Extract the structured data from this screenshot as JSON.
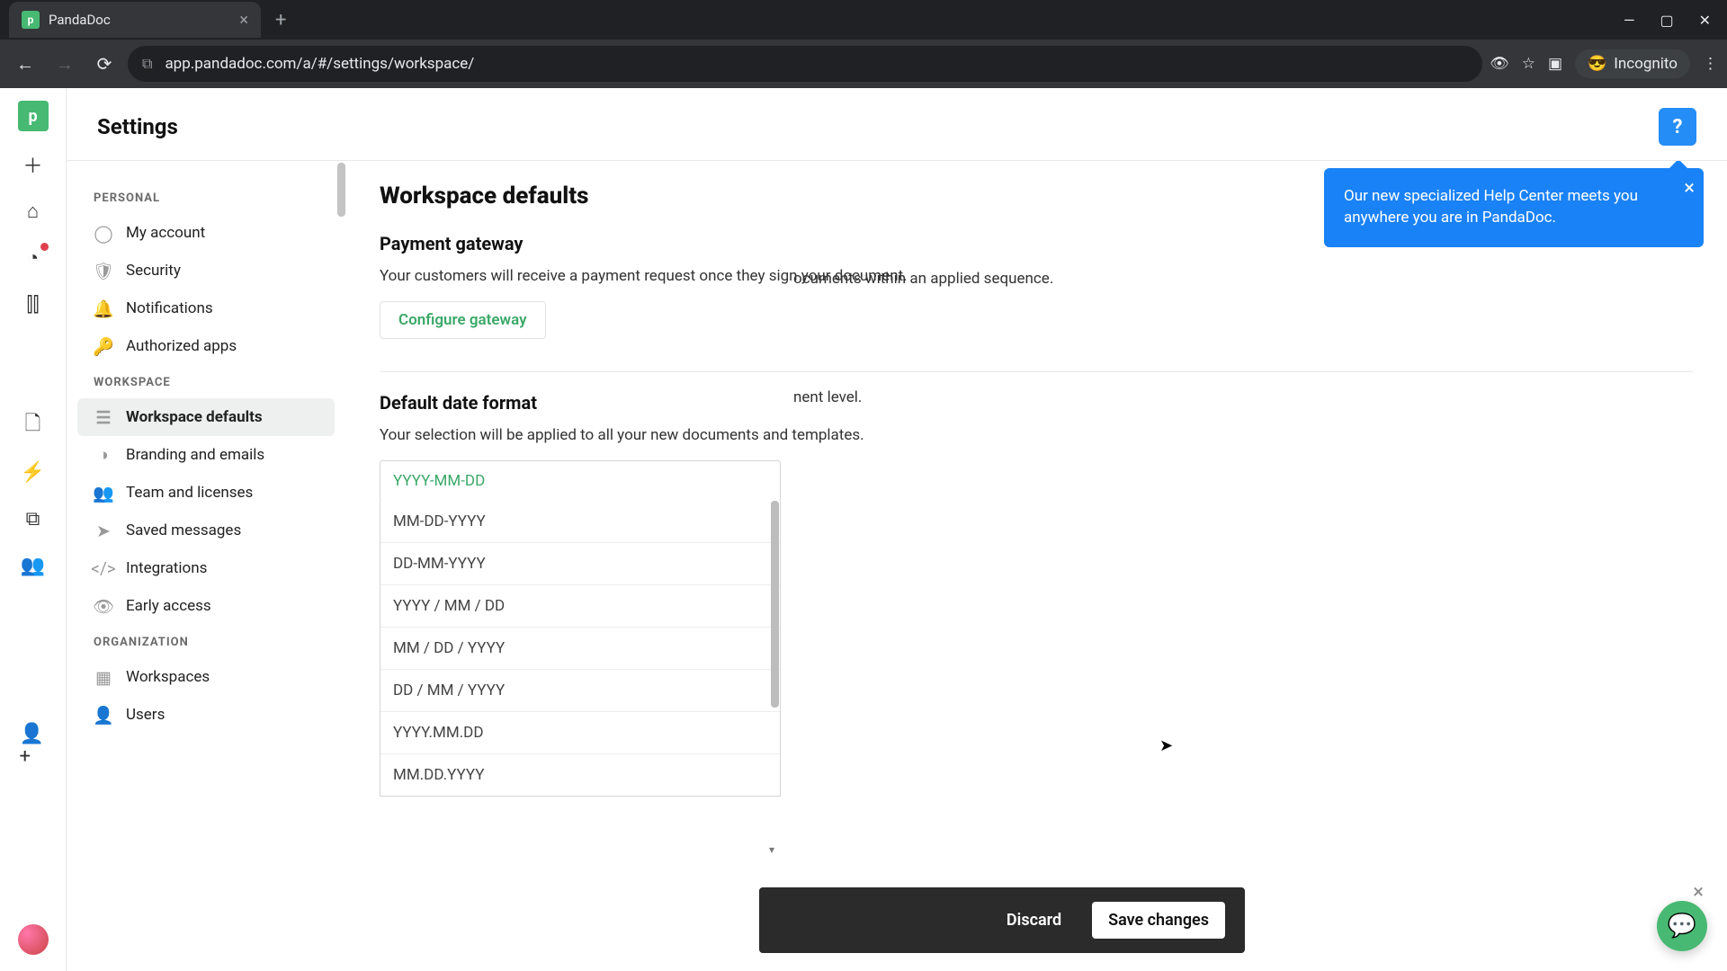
{
  "browser": {
    "tab_title": "PandaDoc",
    "url": "app.pandadoc.com/a/#/settings/workspace/",
    "incognito_label": "Incognito"
  },
  "header": {
    "title": "Settings"
  },
  "sidebar": {
    "personal_label": "PERSONAL",
    "workspace_label": "WORKSPACE",
    "organization_label": "ORGANIZATION",
    "personal": [
      {
        "label": "My account"
      },
      {
        "label": "Security"
      },
      {
        "label": "Notifications"
      },
      {
        "label": "Authorized apps"
      }
    ],
    "workspace": [
      {
        "label": "Workspace defaults"
      },
      {
        "label": "Branding and emails"
      },
      {
        "label": "Team and licenses"
      },
      {
        "label": "Saved messages"
      },
      {
        "label": "Integrations"
      },
      {
        "label": "Early access"
      }
    ],
    "organization": [
      {
        "label": "Workspaces"
      },
      {
        "label": "Users"
      }
    ]
  },
  "panel": {
    "title": "Workspace defaults",
    "payment_head": "Payment gateway",
    "payment_desc": "Your customers will receive a payment request once they sign your document.",
    "configure_label": "Configure gateway",
    "date_head": "Default date format",
    "date_desc": "Your selection will be applied to all your new documents and templates.",
    "obscured1": "ocuments within an applied sequence.",
    "obscured2": "nent level."
  },
  "date_dropdown": {
    "selected": "YYYY-MM-DD",
    "options": [
      "MM-DD-YYYY",
      "DD-MM-YYYY",
      "YYYY / MM / DD",
      "MM / DD / YYYY",
      "DD / MM / YYYY",
      "YYYY.MM.DD",
      "MM.DD.YYYY"
    ]
  },
  "tooltip": {
    "text": "Our new specialized Help Center meets you anywhere you are in PandaDoc."
  },
  "savebar": {
    "discard": "Discard",
    "save": "Save changes"
  }
}
